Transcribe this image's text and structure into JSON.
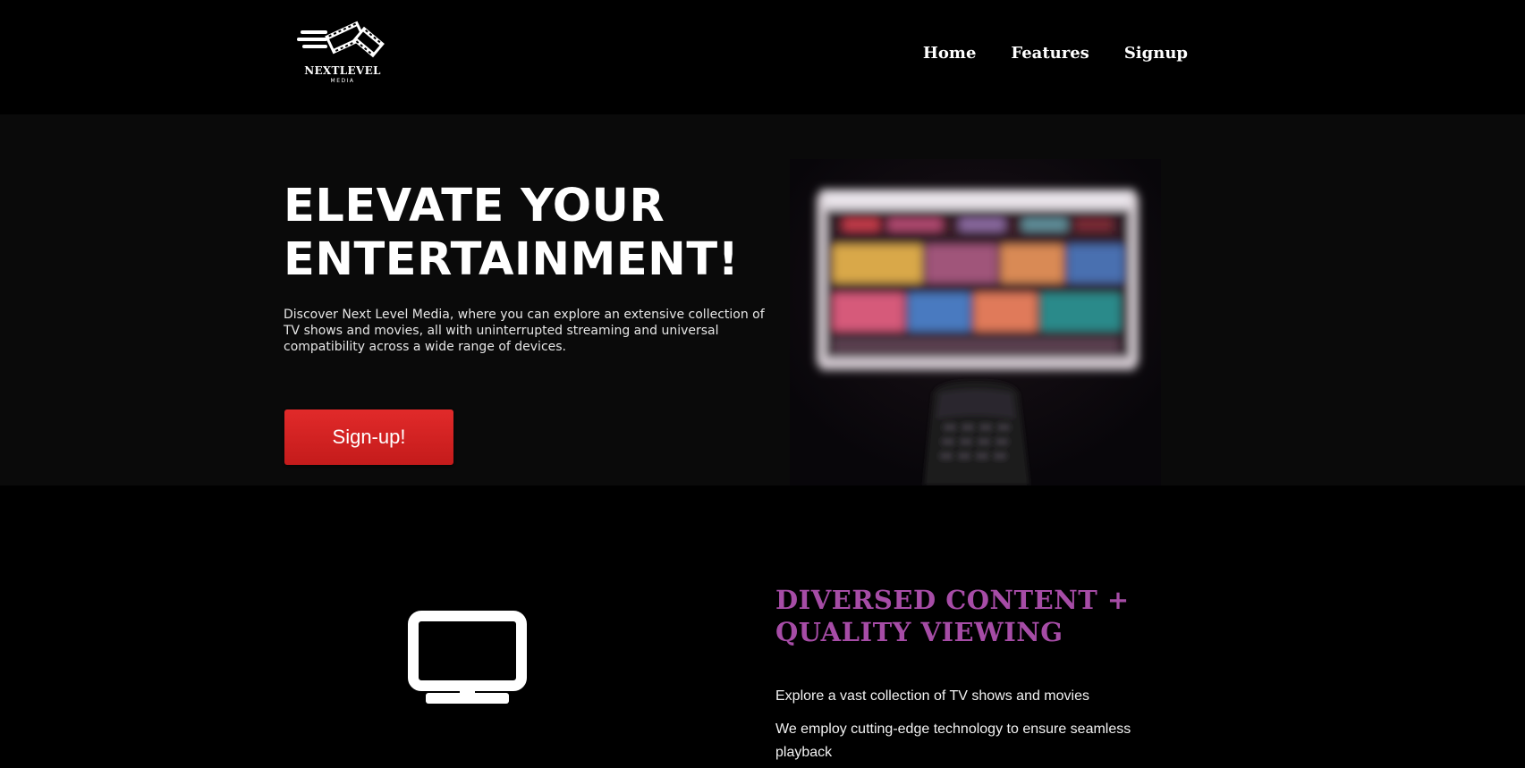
{
  "brand": {
    "name": "NEXTLEVEL",
    "tagline": "MEDIA",
    "logo_icon": "film-reel-speed-icon"
  },
  "nav": {
    "items": [
      {
        "label": "Home"
      },
      {
        "label": "Features"
      },
      {
        "label": "Signup"
      }
    ]
  },
  "hero": {
    "title_line1": "ELEVATE YOUR",
    "title_line2": "ENTERTAINMENT!",
    "description": "Discover Next Level Media, where you can explore an extensive collection of TV shows and movies, all with uninterrupted streaming and universal compatibility across a wide range of devices.",
    "cta_label": "Sign-up!",
    "image_alt": "blurred-tv-with-remote",
    "cta_color": "#d92424"
  },
  "feature": {
    "icon": "tv-monitor-icon",
    "title_line1": "DIVERSED CONTENT +",
    "title_line2": "QUALITY VIEWING",
    "points": [
      "Explore a vast collection of TV shows and movies",
      "We employ cutting-edge technology to ensure seamless playback"
    ],
    "title_color": "#a64ca6"
  }
}
